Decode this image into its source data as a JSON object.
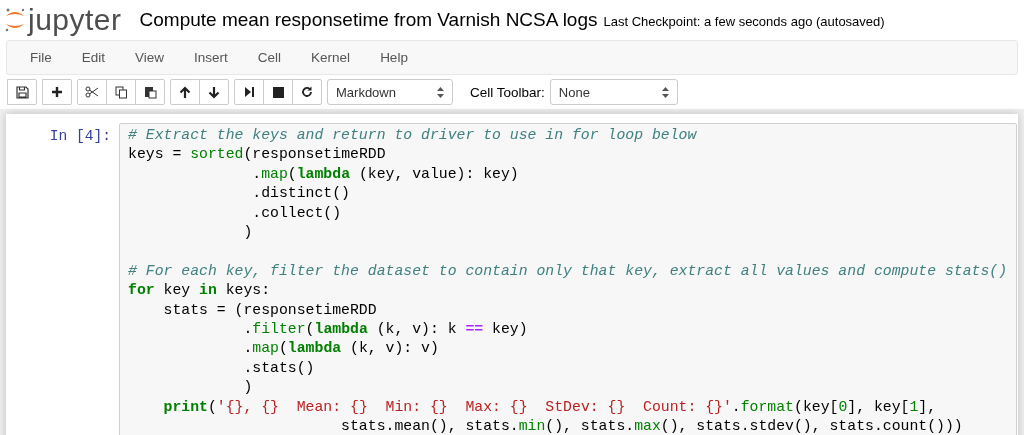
{
  "header": {
    "logo_text": "jupyter",
    "title": "Compute mean responsetime from Varnish NCSA logs",
    "checkpoint": "Last Checkpoint: a few seconds ago (autosaved)"
  },
  "menu": [
    "File",
    "Edit",
    "View",
    "Insert",
    "Cell",
    "Kernel",
    "Help"
  ],
  "toolbar": {
    "cell_type": "Markdown",
    "cell_toolbar_label": "Cell Toolbar:",
    "cell_toolbar_value": "None"
  },
  "cell": {
    "prompt": "In [4]:",
    "lines": [
      [
        {
          "t": "# Extract the keys and return to driver to use in for loop below",
          "kind": "comment"
        }
      ],
      [
        {
          "t": "keys = ",
          "kind": "plain"
        },
        {
          "t": "sorted",
          "kind": "builtin"
        },
        {
          "t": "(responsetimeRDD",
          "kind": "plain"
        }
      ],
      [
        {
          "t": "              .",
          "kind": "plain"
        },
        {
          "t": "map",
          "kind": "builtin"
        },
        {
          "t": "(",
          "kind": "plain"
        },
        {
          "t": "lambda",
          "kind": "keyword"
        },
        {
          "t": " (key, value): key)",
          "kind": "plain"
        }
      ],
      [
        {
          "t": "              .distinct()",
          "kind": "plain"
        }
      ],
      [
        {
          "t": "              .collect()",
          "kind": "plain"
        }
      ],
      [
        {
          "t": "             )",
          "kind": "plain"
        }
      ],
      [
        {
          "t": "# For each key, filter the dataset to contain only that key, extract all values and compute stats()",
          "kind": "comment",
          "blank_before": true
        }
      ],
      [
        {
          "t": "for",
          "kind": "keyword"
        },
        {
          "t": " key ",
          "kind": "plain"
        },
        {
          "t": "in",
          "kind": "keyword"
        },
        {
          "t": " keys:",
          "kind": "plain"
        }
      ],
      [
        {
          "t": "    stats = (responsetimeRDD",
          "kind": "plain"
        }
      ],
      [
        {
          "t": "             .",
          "kind": "plain"
        },
        {
          "t": "filter",
          "kind": "builtin"
        },
        {
          "t": "(",
          "kind": "plain"
        },
        {
          "t": "lambda",
          "kind": "keyword"
        },
        {
          "t": " (k, v): k ",
          "kind": "plain"
        },
        {
          "t": "==",
          "kind": "operator"
        },
        {
          "t": " key)",
          "kind": "plain"
        }
      ],
      [
        {
          "t": "             .",
          "kind": "plain"
        },
        {
          "t": "map",
          "kind": "builtin"
        },
        {
          "t": "(",
          "kind": "plain"
        },
        {
          "t": "lambda",
          "kind": "keyword"
        },
        {
          "t": " (k, v): v)",
          "kind": "plain"
        }
      ],
      [
        {
          "t": "             .stats()",
          "kind": "plain"
        }
      ],
      [
        {
          "t": "             )",
          "kind": "plain"
        }
      ],
      [
        {
          "t": "    print",
          "kind": "keyword"
        },
        {
          "t": "(",
          "kind": "plain"
        },
        {
          "t": "'{}, {}  Mean: {}  Min: {}  Max: {}  StDev: {}  Count: {}'",
          "kind": "string"
        },
        {
          "t": ".",
          "kind": "plain"
        },
        {
          "t": "format",
          "kind": "builtin"
        },
        {
          "t": "(key[",
          "kind": "plain"
        },
        {
          "t": "0",
          "kind": "number"
        },
        {
          "t": "], key[",
          "kind": "plain"
        },
        {
          "t": "1",
          "kind": "number"
        },
        {
          "t": "],",
          "kind": "plain"
        }
      ],
      [
        {
          "t": "                        stats.mean(), stats.",
          "kind": "plain"
        },
        {
          "t": "min",
          "kind": "builtin"
        },
        {
          "t": "(), stats.",
          "kind": "plain"
        },
        {
          "t": "max",
          "kind": "builtin"
        },
        {
          "t": "(), stats.stdev(), stats.count()))",
          "kind": "plain"
        }
      ]
    ]
  }
}
